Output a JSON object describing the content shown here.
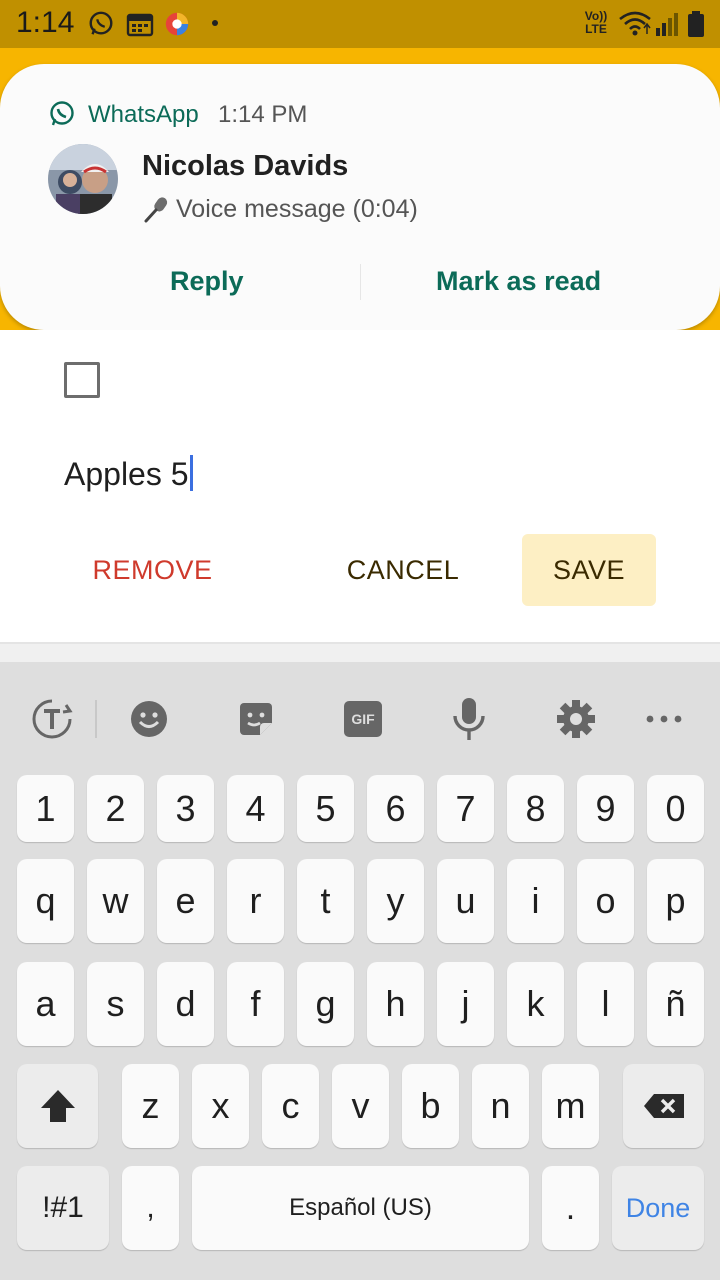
{
  "status_bar": {
    "time": "1:14",
    "icons": [
      "whatsapp-status-icon",
      "calendar-icon",
      "browser-icon",
      "volte-icon",
      "wifi-icon",
      "signal-icon",
      "battery-icon"
    ],
    "volte_label_top": "Vo))",
    "volte_label_bottom": "LTE"
  },
  "notification": {
    "app_name": "WhatsApp",
    "time": "1:14 PM",
    "sender": "Nicolas Davids",
    "message": "Voice message (0:04)",
    "actions": {
      "reply": "Reply",
      "mark_read": "Mark as read"
    },
    "accent_color": "#0c6b58"
  },
  "dialog": {
    "item_text": "Apples 5",
    "checked": false,
    "buttons": {
      "remove": "REMOVE",
      "cancel": "CANCEL",
      "save": "SAVE"
    },
    "colors": {
      "remove": "#cf3a2c",
      "save_bg": "#fdefc4"
    }
  },
  "keyboard": {
    "toolbar": [
      "translate-icon",
      "emoji-icon",
      "sticker-icon",
      "gif-icon",
      "microphone-icon",
      "settings-icon",
      "more-icon"
    ],
    "gif_label": "GIF",
    "rows": {
      "numbers": [
        "1",
        "2",
        "3",
        "4",
        "5",
        "6",
        "7",
        "8",
        "9",
        "0"
      ],
      "row1": [
        "q",
        "w",
        "e",
        "r",
        "t",
        "y",
        "u",
        "i",
        "o",
        "p"
      ],
      "row2": [
        "a",
        "s",
        "d",
        "f",
        "g",
        "h",
        "j",
        "k",
        "l",
        "ñ"
      ],
      "row3": [
        "z",
        "x",
        "c",
        "v",
        "b",
        "n",
        "m"
      ]
    },
    "symbols_key": "!#1",
    "comma_key": ",",
    "space_label": "Español (US)",
    "period_key": ".",
    "done_key": "Done"
  }
}
